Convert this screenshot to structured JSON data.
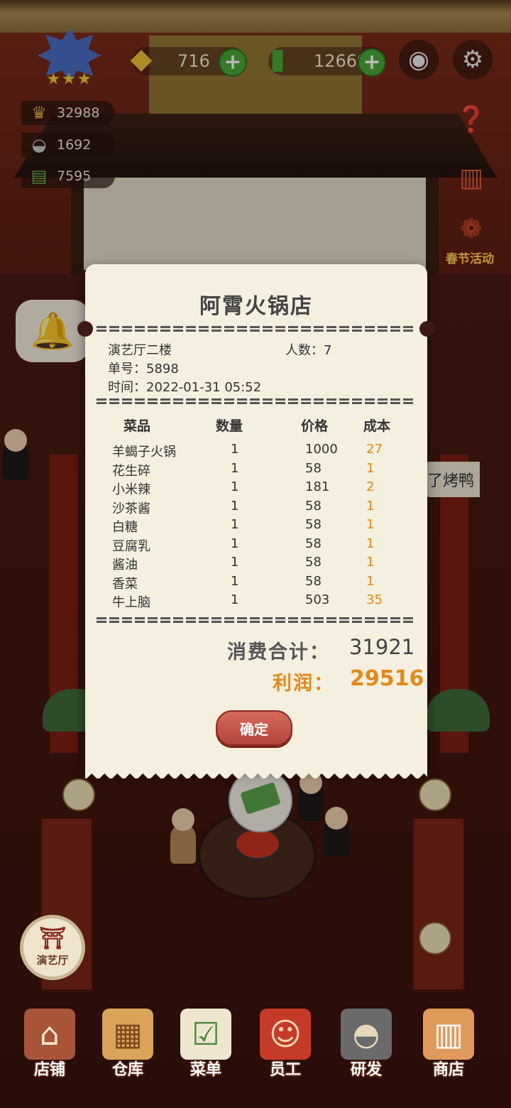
{
  "hud": {
    "gems": "716",
    "cash": "12669",
    "plus_label": "+",
    "stats": {
      "reputation": "32988",
      "dishes": "1692",
      "guests": "7595"
    },
    "event_label": "春节活动",
    "speech_text": "了烤鸭",
    "rating_stars": "★★★"
  },
  "receipt": {
    "title": "阿霄火锅店",
    "hall": "演艺厅二楼",
    "guests_label": "人数：7",
    "order_label": "单号：5898",
    "time_label": "时间：2022-01-31 05:52",
    "columns": {
      "dish": "菜品",
      "qty": "数量",
      "price": "价格",
      "cost": "成本"
    },
    "items": [
      {
        "name": "羊蝎子火锅",
        "qty": "1",
        "price": "1000",
        "cost": "27"
      },
      {
        "name": "花生碎",
        "qty": "1",
        "price": "58",
        "cost": "1"
      },
      {
        "name": "小米辣",
        "qty": "1",
        "price": "181",
        "cost": "2"
      },
      {
        "name": "沙茶酱",
        "qty": "1",
        "price": "58",
        "cost": "1"
      },
      {
        "name": "白糖",
        "qty": "1",
        "price": "58",
        "cost": "1"
      },
      {
        "name": "豆腐乳",
        "qty": "1",
        "price": "58",
        "cost": "1"
      },
      {
        "name": "酱油",
        "qty": "1",
        "price": "58",
        "cost": "1"
      },
      {
        "name": "香菜",
        "qty": "1",
        "price": "58",
        "cost": "1"
      },
      {
        "name": "牛上脑",
        "qty": "1",
        "price": "503",
        "cost": "35"
      }
    ],
    "total_label": "消费合计：",
    "total_value": "31921",
    "profit_label": "利润：",
    "profit_value": "29516",
    "confirm_label": "确定"
  },
  "hall_button_label": "演艺厅",
  "nav": {
    "items": [
      {
        "label": "店铺",
        "icon": "shop-building-icon"
      },
      {
        "label": "仓库",
        "icon": "warehouse-boxes-icon"
      },
      {
        "label": "菜单",
        "icon": "menu-clipboard-icon"
      },
      {
        "label": "员工",
        "icon": "staff-chef-icon"
      },
      {
        "label": "研发",
        "icon": "research-wok-icon"
      },
      {
        "label": "商店",
        "icon": "store-stall-icon"
      }
    ]
  },
  "colors": {
    "accent_orange": "#e08a1c",
    "confirm_red": "#c5564a",
    "plus_green": "#4ba83a"
  }
}
